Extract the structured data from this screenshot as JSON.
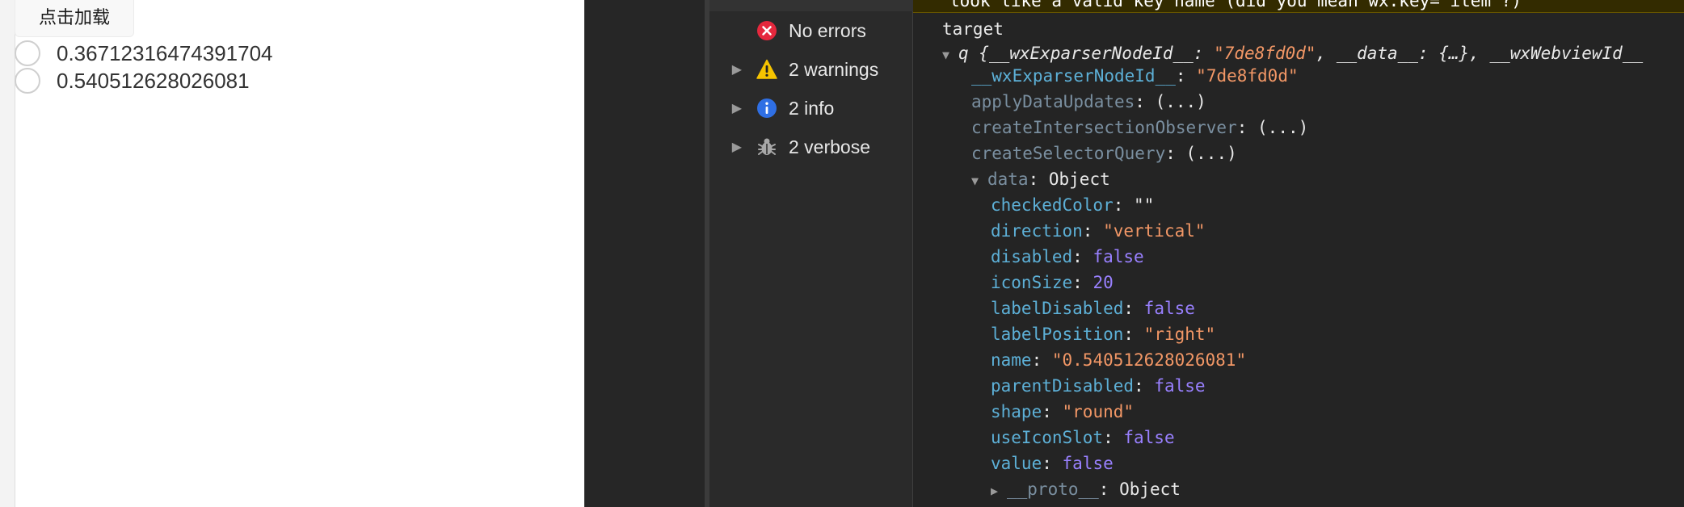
{
  "simulator": {
    "load_button": "点击加载",
    "radios": [
      {
        "label": "0.36712316474391704"
      },
      {
        "label": "0.540512628026081"
      }
    ]
  },
  "sidebar": {
    "items": [
      {
        "label": "No errors",
        "icon": "error-icon",
        "color": "#e5283d"
      },
      {
        "label": "2 warnings",
        "icon": "warning-icon",
        "color": "#f6c400"
      },
      {
        "label": "2 info",
        "icon": "info-icon",
        "color": "#2f6fe4"
      },
      {
        "label": "2 verbose",
        "icon": "bug-icon",
        "color": "#a8a8a8"
      }
    ]
  },
  "console": {
    "warning_text": "look like a valid key name (did you mean wx:key=\"item\"?)",
    "target_label": "target",
    "object_header": {
      "prefix": "q ",
      "text": "{__wxExparserNodeId__: ",
      "id_value": "\"7de8fd0d\"",
      "rest": ", __data__: {…}, __wxWebviewId__"
    },
    "props": [
      {
        "key": "__wxExparserNodeId__",
        "sep": ": ",
        "value": "\"7de8fd0d\"",
        "type": "str",
        "dim": false
      },
      {
        "key": "applyDataUpdates",
        "sep": ": ",
        "value": "(...)",
        "type": "plain",
        "dim": true
      },
      {
        "key": "createIntersectionObserver",
        "sep": ": ",
        "value": "(...)",
        "type": "plain",
        "dim": true
      },
      {
        "key": "createSelectorQuery",
        "sep": ": ",
        "value": "(...)",
        "type": "plain",
        "dim": true
      }
    ],
    "data_node": {
      "key": "data",
      "sep": ": ",
      "value": "Object"
    },
    "data_props": [
      {
        "key": "checkedColor",
        "sep": ": ",
        "value": "\"\"",
        "type": "plain"
      },
      {
        "key": "direction",
        "sep": ": ",
        "value": "\"vertical\"",
        "type": "str"
      },
      {
        "key": "disabled",
        "sep": ": ",
        "value": "false",
        "type": "bool"
      },
      {
        "key": "iconSize",
        "sep": ": ",
        "value": "20",
        "type": "num"
      },
      {
        "key": "labelDisabled",
        "sep": ": ",
        "value": "false",
        "type": "bool"
      },
      {
        "key": "labelPosition",
        "sep": ": ",
        "value": "\"right\"",
        "type": "str"
      },
      {
        "key": "name",
        "sep": ": ",
        "value": "\"0.540512628026081\"",
        "type": "str"
      },
      {
        "key": "parentDisabled",
        "sep": ": ",
        "value": "false",
        "type": "bool"
      },
      {
        "key": "shape",
        "sep": ": ",
        "value": "\"round\"",
        "type": "str"
      },
      {
        "key": "useIconSlot",
        "sep": ": ",
        "value": "false",
        "type": "bool"
      },
      {
        "key": "value",
        "sep": ": ",
        "value": "false",
        "type": "bool"
      }
    ],
    "proto_node": {
      "key": "__proto__",
      "sep": ": ",
      "value": "Object"
    }
  }
}
